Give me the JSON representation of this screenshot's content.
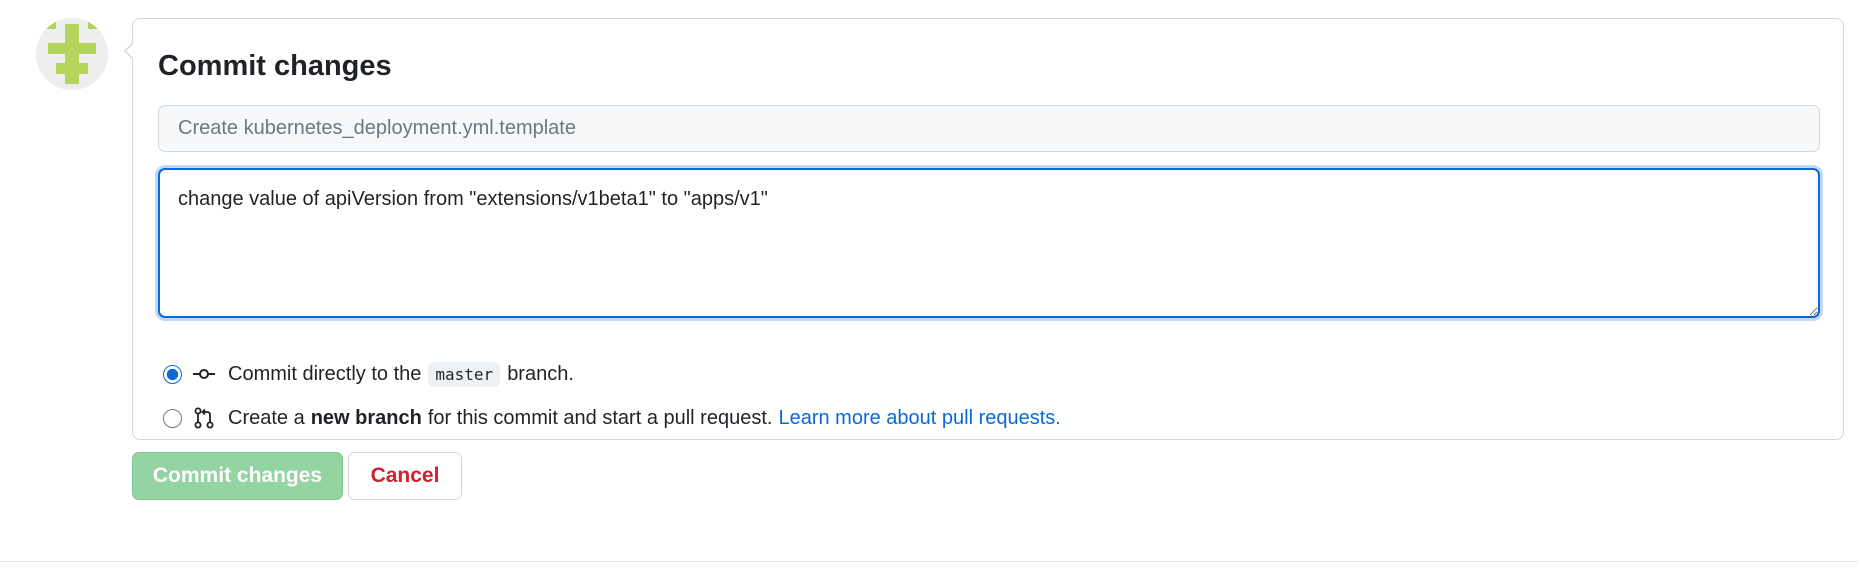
{
  "commit_form": {
    "title": "Commit changes",
    "summary_placeholder": "Create kubernetes_deployment.yml.template",
    "summary_value": "",
    "description_value": "change value of apiVersion from \"extensions/v1beta1\" to \"apps/v1\"",
    "options": {
      "direct": {
        "selected": true,
        "text_before": "Commit directly to the",
        "branch": "master",
        "text_after": "branch.",
        "icon": "git-commit-icon"
      },
      "new_branch": {
        "selected": false,
        "text_before": "Create a",
        "bold": "new branch",
        "text_after": "for this commit and start a pull request.",
        "link": "Learn more about pull requests.",
        "icon": "git-pull-request-icon"
      }
    }
  },
  "buttons": {
    "commit": "Commit changes",
    "cancel": "Cancel"
  },
  "colors": {
    "accent": "#0969da",
    "commit_button": "#94d3a2",
    "cancel_text": "#cf222e",
    "avatar": "#b6d35c"
  }
}
